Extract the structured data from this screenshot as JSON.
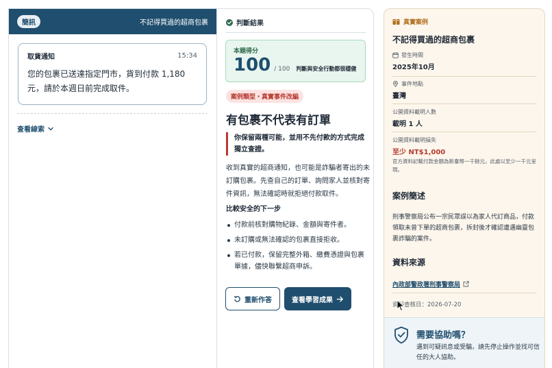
{
  "left": {
    "badge": "簡訊",
    "title": "不記得買過的超商包裹",
    "message": {
      "label": "取貨通知",
      "time": "15:34",
      "body": "您的包裹已送達指定門市，貨到付款 1,180 元，請於本週日前完成取件。"
    },
    "clue_link": "查看線索"
  },
  "middle": {
    "header": "判斷結果",
    "score": {
      "label": "本題得分",
      "value": "100",
      "total": "/ 100",
      "note": "判斷與安全行動都很穩健"
    },
    "case_pill": "案例類型・真實事件改編",
    "headline": "有包裹不代表有訂單",
    "quote": "你保留兩種可能，並用不先付款的方式完成獨立查證。",
    "paragraph": "收到真實的超商通知，也可能是詐騙者寄出的未訂購包裹。先查自己的訂單、詢問家人並核對寄件資訊，無法確認時就拒絕付款取件。",
    "steps_heading": "比較安全的下一步",
    "steps": [
      "付款前核對購物紀錄、金額與寄件者。",
      "未訂購或無法確認的包裹直接拒收。",
      "若已付款，保留完整外箱、繳費憑證與包裹單據，儘快聯繫超商申訴。"
    ],
    "btn_redo": "重新作答",
    "btn_result": "查看學習成果"
  },
  "right": {
    "tag": "真實案例",
    "title": "不記得買過的超商包裹",
    "date_label": "發生時間",
    "date_value": "2025年10月",
    "place_label": "事件地點",
    "place_value": "臺灣",
    "count_label": "公開資料載明人數",
    "count_value": "載明 1 人",
    "loss_label": "公開資料載明損失",
    "loss_value": "至少 NT$1,000",
    "loss_note": "官方資料記載付款金額為新臺幣一千餘元，此處以至少一千元呈現。",
    "summary_heading": "案例簡述",
    "summary": "刑事警察局公布一宗民眾誤以為家人代訂商品，付款領取未曾下單的超商包裹，拆封後才確認遭遇幽靈包裹詐騙的案件。",
    "source_heading": "資料來源",
    "source_link": "內政部警政署刑事警察局",
    "checked_date": "資料查核日：2026-07-20",
    "help_title": "需要協助嗎？",
    "help_text": "遇到可疑訊息或受騙，請先停止操作並找可信任的大人協助。"
  },
  "colors": {
    "primary": "#1f4e6e",
    "danger": "#b63a2f",
    "success_bg": "#e9f6ef",
    "case_bg": "#fdf6ec"
  }
}
